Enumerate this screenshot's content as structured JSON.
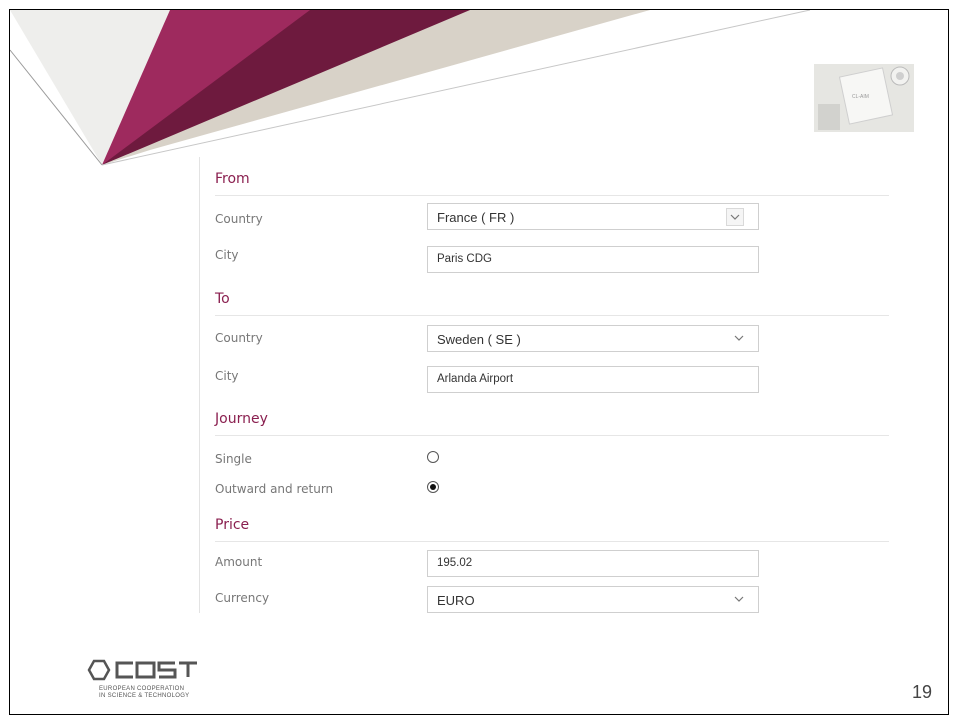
{
  "form": {
    "from": {
      "title": "From",
      "country_label": "Country",
      "country_value": "France ( FR )",
      "city_label": "City",
      "city_value": "Paris CDG"
    },
    "to": {
      "title": "To",
      "country_label": "Country",
      "country_value": "Sweden ( SE )",
      "city_label": "City",
      "city_value": "Arlanda Airport"
    },
    "journey": {
      "title": "Journey",
      "options": [
        {
          "label": "Single",
          "selected": false
        },
        {
          "label": "Outward and return",
          "selected": true
        }
      ]
    },
    "price": {
      "title": "Price",
      "amount_label": "Amount",
      "amount_value": "195.02",
      "currency_label": "Currency",
      "currency_value": "EURO"
    }
  },
  "thumbnail": {
    "text": "CL-AIM"
  },
  "footer": {
    "logo_tagline_1": "EUROPEAN COOPERATION",
    "logo_tagline_2": "IN SCIENCE & TECHNOLOGY",
    "page_number": "19"
  },
  "colors": {
    "accent": "#8a1f4f",
    "deco_dark": "#6e1a3e",
    "deco_beige": "#d8d2c8",
    "deco_grey": "#eeeeec"
  }
}
